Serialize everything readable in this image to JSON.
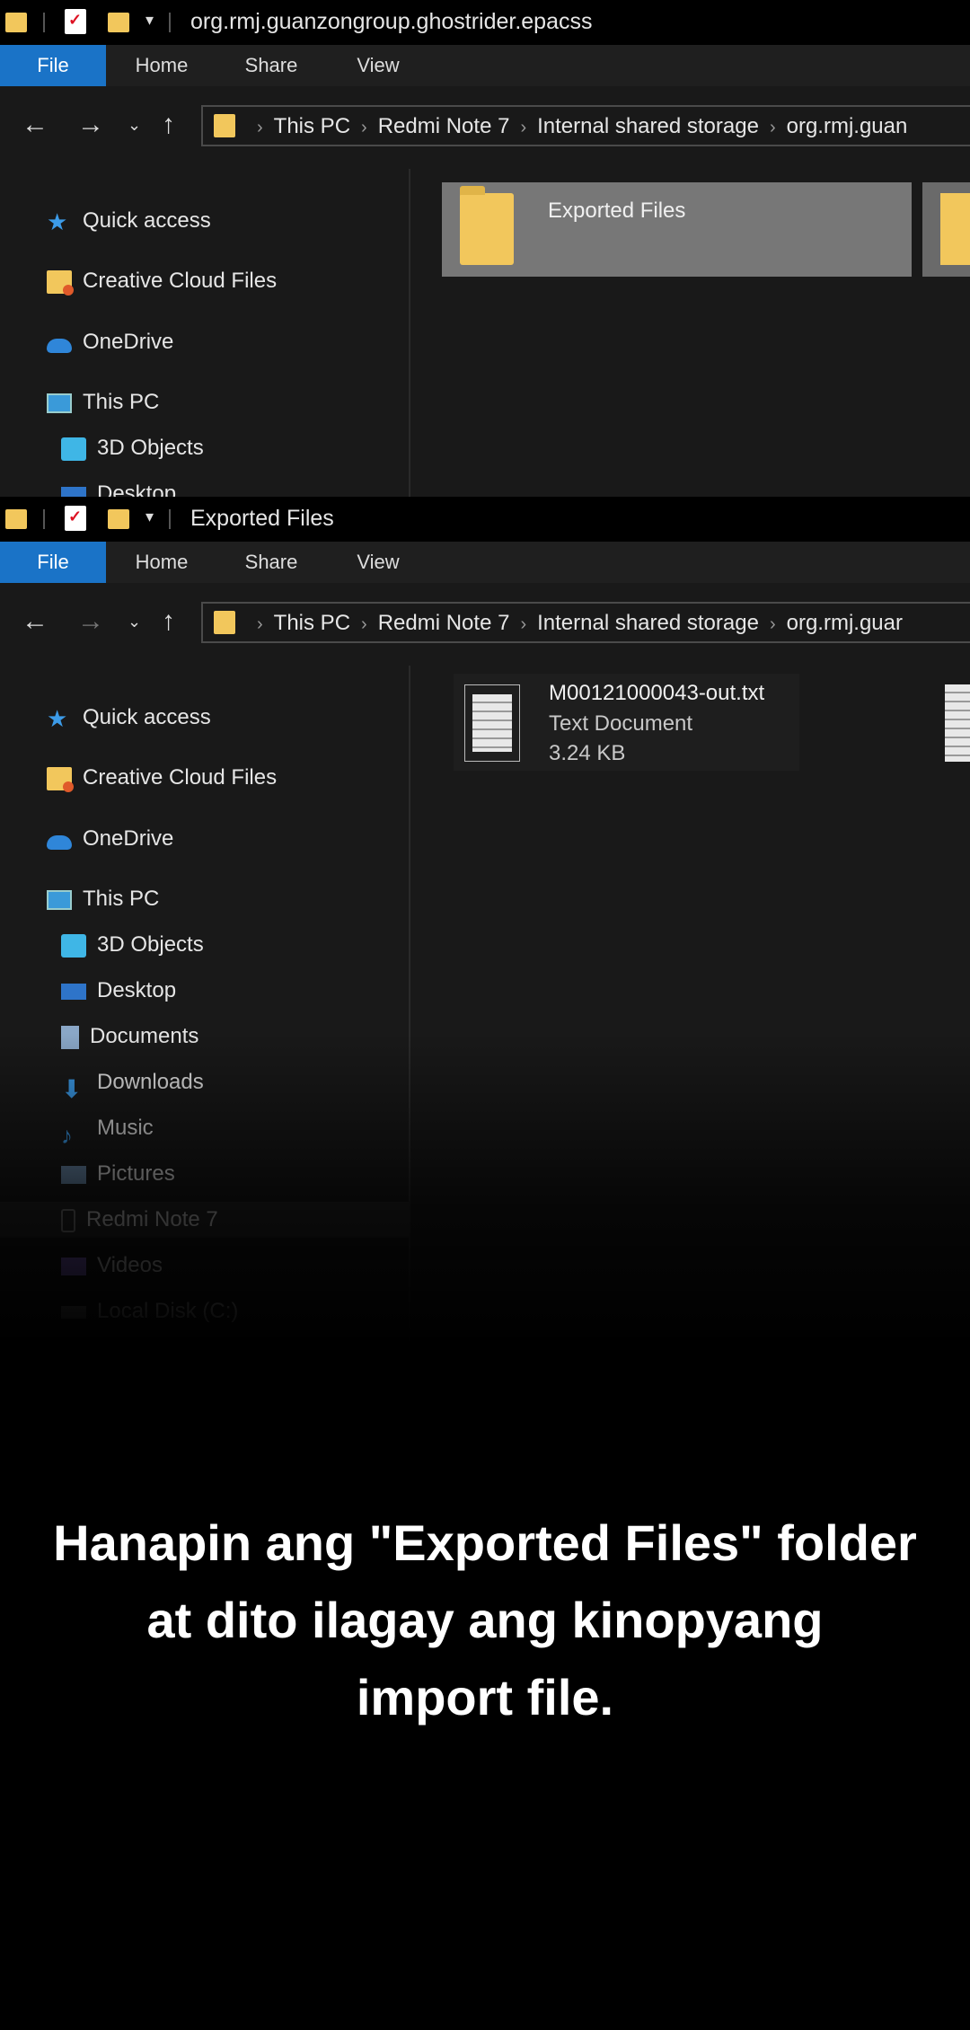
{
  "window1": {
    "title": "org.rmj.guanzongroup.ghostrider.epacss",
    "ribbon_tabs": [
      "File",
      "Home",
      "Share",
      "View"
    ],
    "breadcrumb": [
      "This PC",
      "Redmi Note 7",
      "Internal shared storage",
      "org.rmj.guan"
    ],
    "sidebar": [
      "Quick access",
      "Creative Cloud Files",
      "OneDrive",
      "This PC",
      "3D Objects",
      "Desktop"
    ],
    "folder_label": "Exported Files"
  },
  "window2": {
    "title": "Exported Files",
    "ribbon_tabs": [
      "File",
      "Home",
      "Share",
      "View"
    ],
    "breadcrumb": [
      "This PC",
      "Redmi Note 7",
      "Internal shared storage",
      "org.rmj.guar"
    ],
    "sidebar": [
      "Quick access",
      "Creative Cloud Files",
      "OneDrive",
      "This PC",
      "3D Objects",
      "Desktop",
      "Documents",
      "Downloads",
      "Music",
      "Pictures",
      "Redmi Note 7",
      "Videos",
      "Local Disk (C:)"
    ],
    "file": {
      "name": "M00121000043-out.txt",
      "type": "Text Document",
      "size": "3.24 KB"
    }
  },
  "caption": "Hanapin ang \"Exported Files\" folder\nat dito ilagay ang kinopyang\nimport file."
}
